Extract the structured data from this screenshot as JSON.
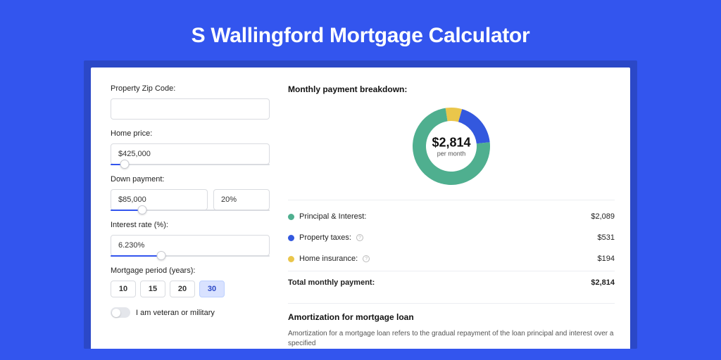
{
  "page_title": "S Wallingford Mortgage Calculator",
  "left": {
    "zip_label": "Property Zip Code:",
    "zip_value": "",
    "home_price_label": "Home price:",
    "home_price_value": "$425,000",
    "home_price_slider_pct": 9,
    "down_payment_label": "Down payment:",
    "down_payment_value": "$85,000",
    "down_payment_pct": "20%",
    "down_payment_slider_pct": 20,
    "interest_label": "Interest rate (%):",
    "interest_value": "6.230%",
    "interest_slider_pct": 32,
    "period_label": "Mortgage period (years):",
    "periods": [
      "10",
      "15",
      "20",
      "30"
    ],
    "period_active_index": 3,
    "veteran_label": "I am veteran or military"
  },
  "breakdown": {
    "title": "Monthly payment breakdown:",
    "center_amount": "$2,814",
    "center_sub": "per month",
    "items": [
      {
        "label": "Principal & Interest:",
        "value": "$2,089",
        "color": "#4faf8f",
        "info": false
      },
      {
        "label": "Property taxes:",
        "value": "$531",
        "color": "#3358de",
        "info": true
      },
      {
        "label": "Home insurance:",
        "value": "$194",
        "color": "#eac64b",
        "info": true
      }
    ],
    "total_label": "Total monthly payment:",
    "total_value": "$2,814"
  },
  "chart_data": {
    "type": "pie",
    "title": "Monthly payment breakdown",
    "series": [
      {
        "name": "Principal & Interest",
        "value": 2089,
        "color": "#4faf8f"
      },
      {
        "name": "Property taxes",
        "value": 531,
        "color": "#3358de"
      },
      {
        "name": "Home insurance",
        "value": 194,
        "color": "#eac64b"
      }
    ],
    "total": 2814,
    "center_label": "$2,814 per month"
  },
  "amort": {
    "title": "Amortization for mortgage loan",
    "body": "Amortization for a mortgage loan refers to the gradual repayment of the loan principal and interest over a specified"
  }
}
